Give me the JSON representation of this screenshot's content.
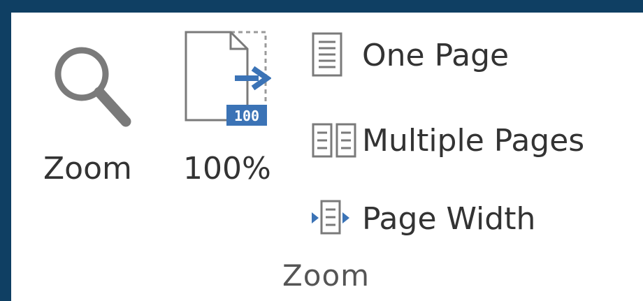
{
  "group": {
    "label": "Zoom"
  },
  "buttons": {
    "zoom": {
      "label": "Zoom",
      "icon": "magnifier-icon"
    },
    "hundred": {
      "label": "100%",
      "badge": "100",
      "icon": "page-arrow-icon"
    },
    "one_page": {
      "label": "One Page",
      "icon": "single-page-icon"
    },
    "multiple_pages": {
      "label": "Multiple Pages",
      "icon": "two-pages-icon"
    },
    "page_width": {
      "label": "Page Width",
      "icon": "page-width-icon"
    }
  },
  "colors": {
    "frame": "#0f3f63",
    "accent": "#3b73b6",
    "icon_gray": "#7a7a7a"
  }
}
